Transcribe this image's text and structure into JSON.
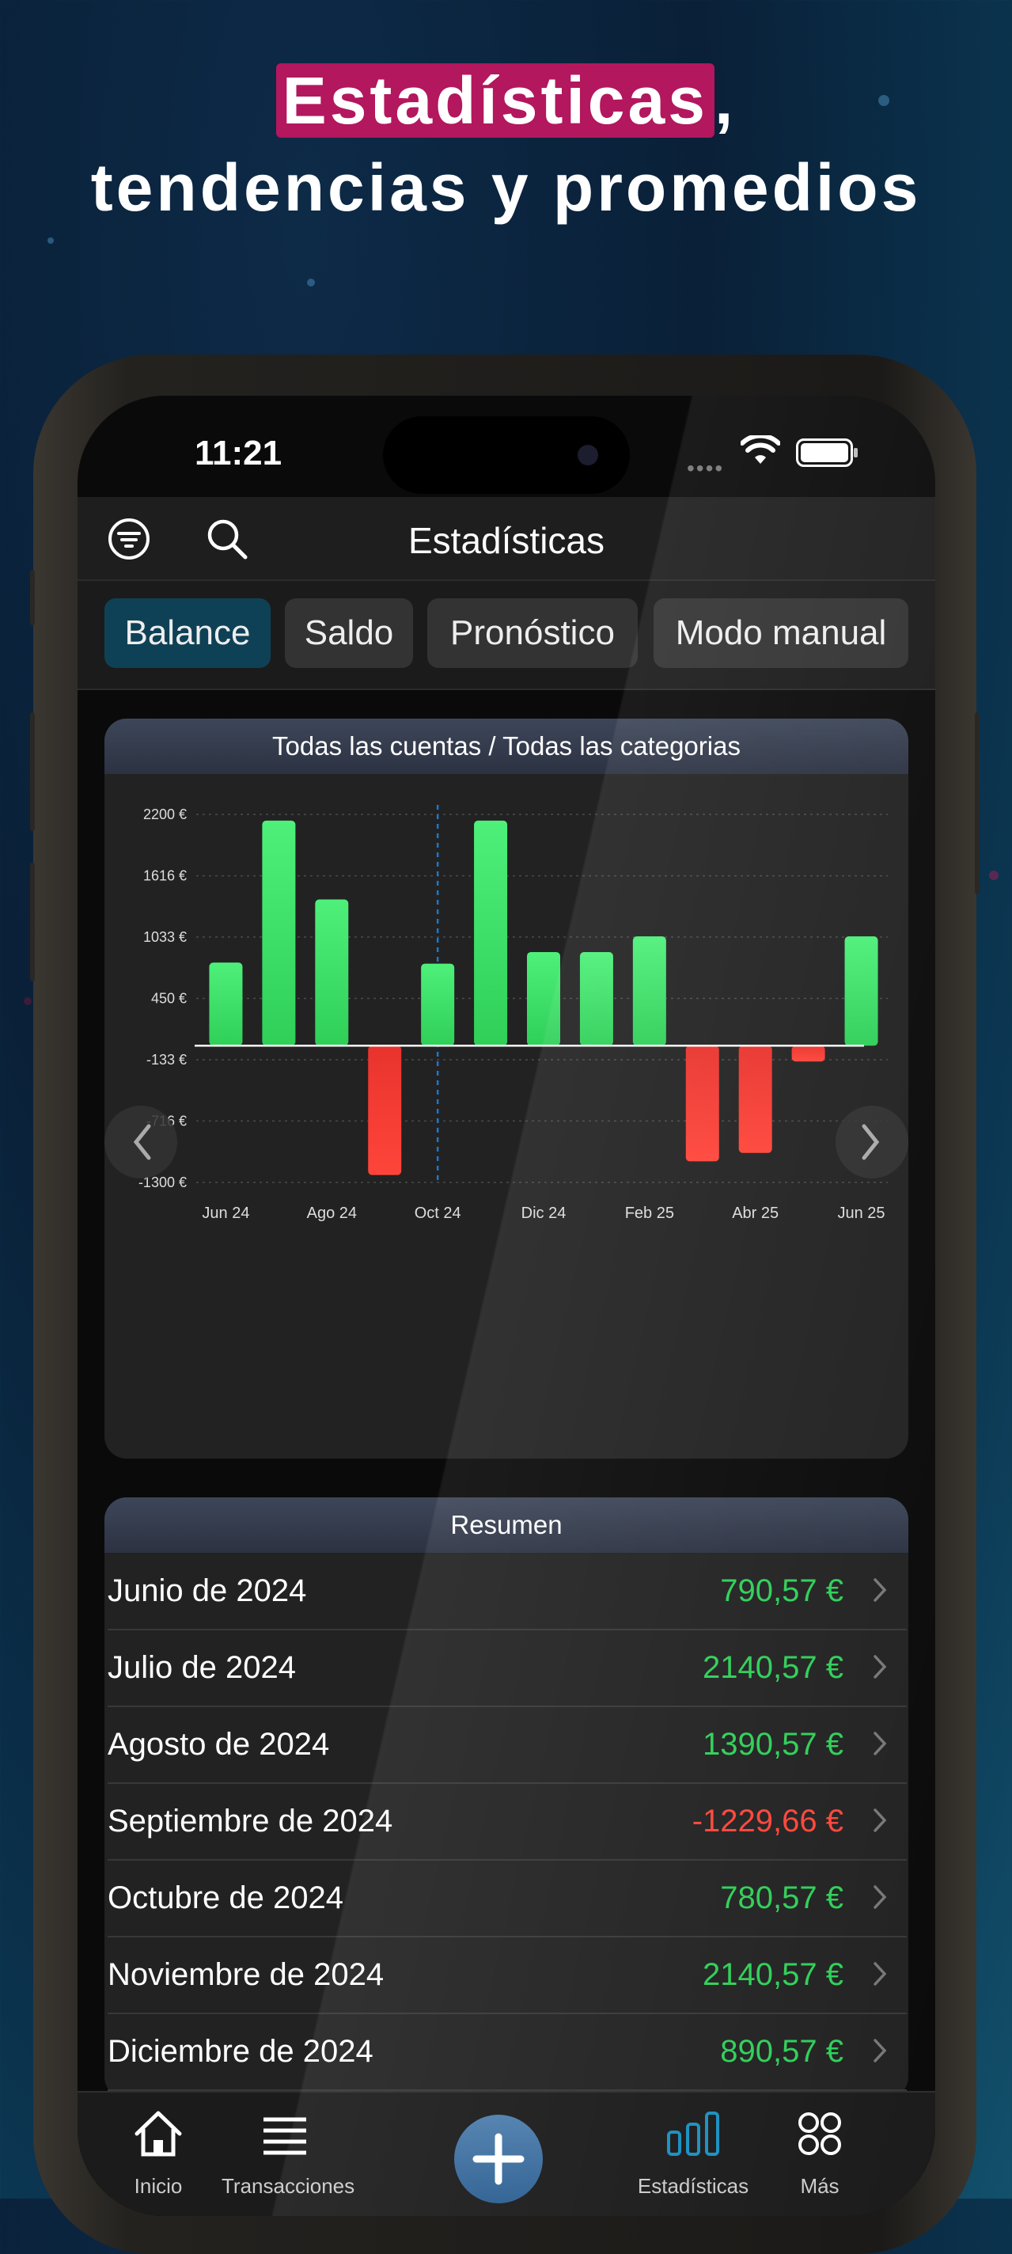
{
  "headline": {
    "highlight": "Estadísticas",
    "comma": ",",
    "line2": "tendencias y promedios"
  },
  "colors": {
    "accent_highlight": "#b3175e",
    "positive": "#2fcf58",
    "negative": "#ff453a",
    "active_tab": "#1a8fc0",
    "segment_active": "#0f4156"
  },
  "status_bar": {
    "time": "11:21"
  },
  "nav": {
    "title": "Estadísticas",
    "left_icons": [
      "filter-icon",
      "search-icon"
    ]
  },
  "segments": [
    {
      "label": "Balance",
      "active": true
    },
    {
      "label": "Saldo",
      "active": false
    },
    {
      "label": "Pronóstico",
      "active": false
    },
    {
      "label": "Modo manual",
      "active": false
    }
  ],
  "chart_card": {
    "title": "Todas las cuentas / Todas las categorias"
  },
  "chart_data": {
    "type": "bar",
    "title": "Todas las cuentas / Todas las categorias",
    "categories": [
      "Jun 24",
      "Jul 24",
      "Ago 24",
      "Sep 24",
      "Oct 24",
      "Nov 24",
      "Dic 24",
      "Ene 25",
      "Feb 25",
      "Mar 25",
      "Abr 25",
      "May 25",
      "Jun 25"
    ],
    "x_tick_labels": [
      "Jun 24",
      "Ago 24",
      "Oct 24",
      "Dic 24",
      "Feb 25",
      "Abr 25",
      "Jun 25"
    ],
    "values": [
      790.57,
      2140.57,
      1390.57,
      -1229.66,
      780.57,
      2140.57,
      890.57,
      890,
      1040,
      -1100,
      -1020,
      -150,
      1040
    ],
    "y_tick_labels": [
      "2200 €",
      "1616 €",
      "1033 €",
      "450 €",
      "-133 €",
      "-716 €",
      "-1300 €"
    ],
    "y_ticks": [
      2200,
      1616,
      1033,
      450,
      -133,
      -716,
      -1300
    ],
    "ylim": [
      -1300,
      2200
    ],
    "marker_category": "Oct 24",
    "grid": true,
    "positive_color": "#2fcf58",
    "negative_color": "#ff453a"
  },
  "summary": {
    "title": "Resumen",
    "rows": [
      {
        "label": "Junio de 2024",
        "value": "790,57 €",
        "sign": "positive"
      },
      {
        "label": "Julio de 2024",
        "value": "2140,57 €",
        "sign": "positive"
      },
      {
        "label": "Agosto de 2024",
        "value": "1390,57 €",
        "sign": "positive"
      },
      {
        "label": "Septiembre de 2024",
        "value": "-1229,66 €",
        "sign": "negative"
      },
      {
        "label": "Octubre de 2024",
        "value": "780,57 €",
        "sign": "positive"
      },
      {
        "label": "Noviembre de 2024",
        "value": "2140,57 €",
        "sign": "positive"
      },
      {
        "label": "Diciembre de 2024",
        "value": "890,57 €",
        "sign": "positive"
      }
    ]
  },
  "tabbar": {
    "tabs": [
      {
        "label": "Inicio",
        "icon": "home-icon"
      },
      {
        "label": "Transacciones",
        "icon": "list-icon"
      },
      {
        "label": "",
        "icon": "plus-icon"
      },
      {
        "label": "Estadísticas",
        "icon": "bar-chart-icon",
        "active": true
      },
      {
        "label": "Más",
        "icon": "grid-circles-icon"
      }
    ]
  }
}
